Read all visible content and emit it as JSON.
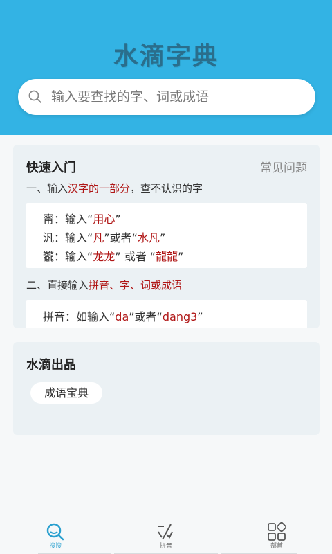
{
  "header": {
    "title": "水滴字典",
    "search_placeholder": "输入要查找的字、词或成语"
  },
  "quick_start": {
    "title": "快速入门",
    "faq": "常见问题",
    "step1": {
      "prefix": "一、输入",
      "highlight": "汉字的一部分",
      "suffix": "，查不认识的字"
    },
    "examples1": [
      {
        "char": "甯",
        "parts": [
          "：输入“",
          "用心",
          "”"
        ]
      },
      {
        "char": "汎",
        "parts": [
          "：输入“",
          "凡",
          "”或者“",
          "水凡",
          "”"
        ]
      },
      {
        "char": "龖",
        "parts": [
          "：输入“",
          "龙龙",
          "” 或者 “",
          "龍龍",
          "”"
        ]
      }
    ],
    "step2": {
      "prefix": "二、直接输入",
      "highlight": "拼音、字、词或成语"
    },
    "example2": {
      "label": "拼音：如输入“",
      "v1": "da",
      "mid": "”或者“",
      "v2": "dang3",
      "end": "”"
    }
  },
  "products": {
    "title": "水滴出品",
    "items": [
      "成语宝典"
    ]
  },
  "tabbar": {
    "tabs": [
      {
        "label": "搜搜",
        "icon": "search-icon",
        "active": true
      },
      {
        "label": "拼音",
        "icon": "pinyin-icon",
        "active": false
      },
      {
        "label": "部首",
        "icon": "radical-grid-icon",
        "active": false
      }
    ]
  },
  "colors": {
    "header": "#33b3e4",
    "highlight": "#b01616",
    "card": "#ebf1f4",
    "active_tab": "#2aa0cf"
  }
}
